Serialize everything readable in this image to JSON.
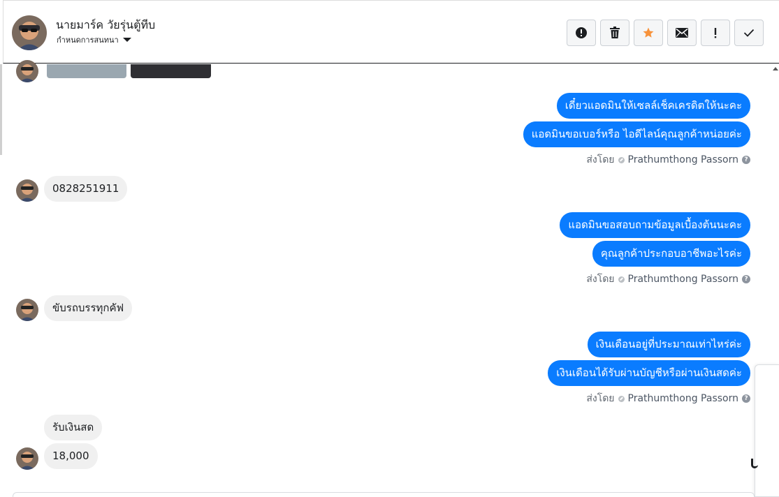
{
  "header": {
    "contact_name": "นายมาร์ค วัยรุ่นตู้ทีบ",
    "subtitle": "กำหนดการสนทนา",
    "actions": [
      {
        "name": "report-button",
        "icon": "alert-circle-icon"
      },
      {
        "name": "delete-button",
        "icon": "trash-icon"
      },
      {
        "name": "star-button",
        "icon": "star-icon"
      },
      {
        "name": "unread-button",
        "icon": "envelope-icon"
      },
      {
        "name": "important-button",
        "icon": "exclamation-icon"
      },
      {
        "name": "done-button",
        "icon": "check-icon"
      }
    ]
  },
  "colors": {
    "outgoing_bubble": "#0a7cff",
    "incoming_bubble": "#f0f0f0",
    "star": "#f7923a"
  },
  "sent_by": {
    "prefix": "ส่งโดย",
    "agent": "Prathumthong Passorn"
  },
  "messages": {
    "out1a": "เดี๋ยวแอดมินให้เซลล์เช็คเครดิตให้นะคะ",
    "out1b": "แอดมินขอเบอร์หรือ ไอดีไลน์คุณลูกค้าหน่อยค่ะ",
    "in1": "0828251911",
    "out2a": "แอดมินขอสอบถามข้อมูลเบื้องต้นนะคะ",
    "out2b": "คุณลูกค้าประกอบอาชีพอะไรค่ะ",
    "in2": "ขับรถบรรทุกคัฟ",
    "out3a": "เงินเดือนอยู่ที่ประมาณเท่าไหร่ค่ะ",
    "out3b": "เงินเดือนได้รับผ่านบัญชีหรือผ่านเงินสดค่ะ",
    "in3a": "รับเงินสด",
    "in3b": "18,000"
  }
}
